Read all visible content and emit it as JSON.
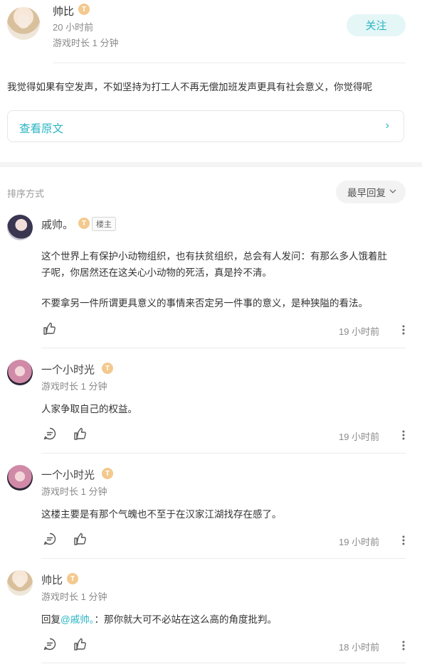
{
  "post": {
    "author": {
      "name": "帅比",
      "time": "20 小时前",
      "playtime": "游戏时长 1 分钟",
      "badge": "T"
    },
    "follow_label": "关注",
    "content": "我觉得如果有空发声，不如坚持为打工人不再无偿加班发声更具有社会意义，你觉得呢",
    "view_original_label": "查看原文",
    "view_original_chevron": "›"
  },
  "sort": {
    "label": "排序方式",
    "current": "最早回复"
  },
  "comments": [
    {
      "name": "戚帅。",
      "badge": "T",
      "owner_tag": "楼主",
      "paragraphs": [
        "这个世界上有保护小动物组织，也有扶贫组织，总会有人发问：有那么多人饿着肚",
        "子呢，你居然还在这关心小动物的死活，真是拎不清。",
        "不要拿另一件所谓更具意义的事情来否定另一件事的意义，是种狭隘的看法。"
      ],
      "time": "19 小时前"
    },
    {
      "name": "一个小时光",
      "badge": "T",
      "playtime": "游戏时长 1 分钟",
      "text": "人家争取自己的权益。",
      "time": "19 小时前"
    },
    {
      "name": "一个小时光",
      "badge": "T",
      "playtime": "游戏时长 1 分钟",
      "text": "这楼主要是有那个气魄也不至于在汉家江湖找存在感了。",
      "time": "19 小时前"
    },
    {
      "name": "帅比",
      "badge": "T",
      "playtime": "游戏时长 1 分钟",
      "reply_prefix": "回复",
      "mention": "@戚帅。",
      "text": "：那你就大可不必站在这么高的角度批判。",
      "time": "18 小时前"
    }
  ],
  "colors": {
    "accent": "#2ab5c3",
    "badge": "#f3c98e"
  }
}
